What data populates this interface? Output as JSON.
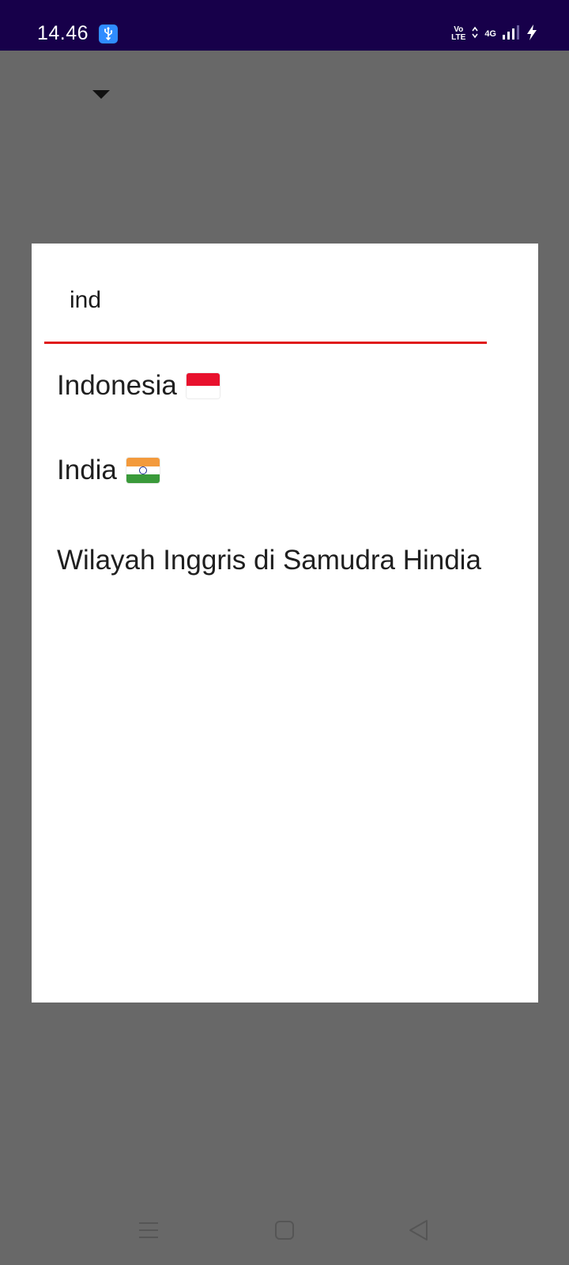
{
  "status_bar": {
    "time": "14.46",
    "usb_icon": "usb-debug-icon",
    "volte_line1": "Vo",
    "volte_line2": "LTE",
    "network": "4G",
    "signal_icon": "signal-bars-icon",
    "battery_icon": "charging-bolt-icon",
    "background_color": "#17004a"
  },
  "background": {
    "dropdown_icon": "dropdown-caret-icon",
    "scrim_color": "#686868"
  },
  "dialog": {
    "search": {
      "value": "ind",
      "underline_color": "#e01b1b"
    },
    "results": [
      {
        "name": "Indonesia",
        "flag_icon": "indonesia-flag-icon"
      },
      {
        "name": "India",
        "flag_icon": "india-flag-icon"
      },
      {
        "name": "Wilayah Inggris di Samudra Hindia",
        "flag_icon": ""
      }
    ]
  },
  "nav_bar": {
    "buttons": [
      "menu-icon",
      "home-icon",
      "back-icon"
    ]
  }
}
